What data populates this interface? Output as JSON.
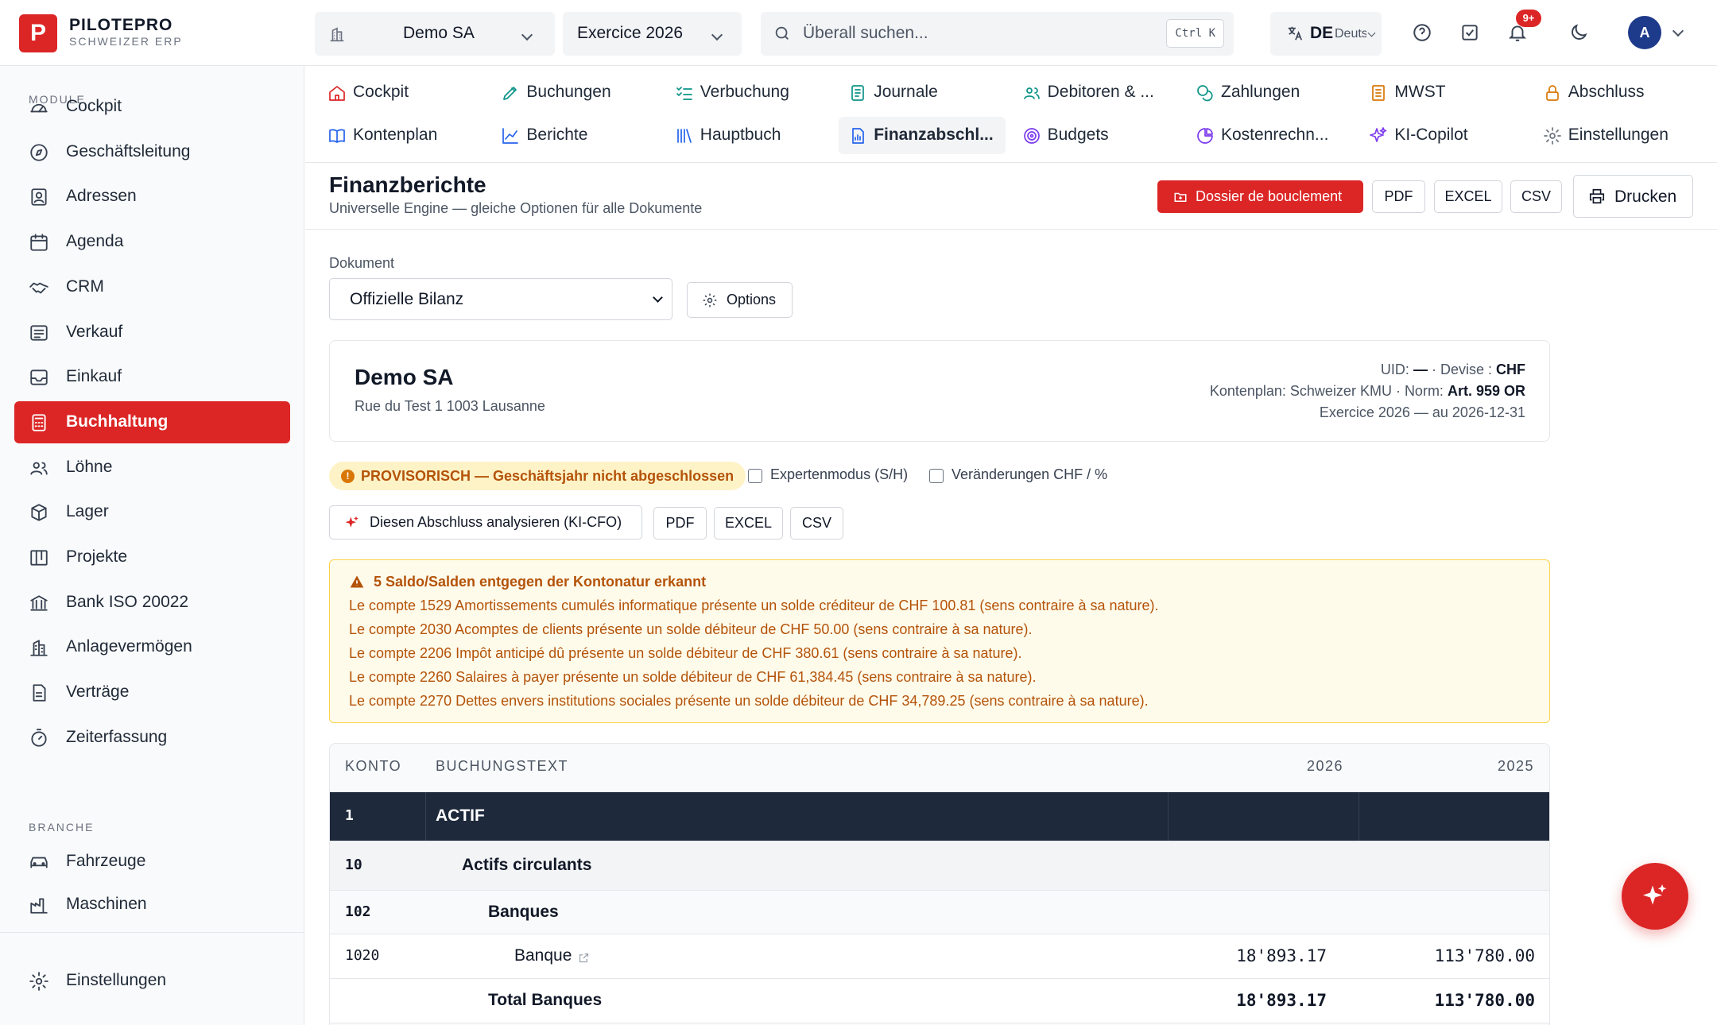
{
  "brand": {
    "logo_letter": "P",
    "name": "PILOTEPRO",
    "subtitle": "SCHWEIZER ERP"
  },
  "topbar": {
    "company": "Demo SA",
    "fiscal_year": "Exercice 2026",
    "search_placeholder": "Überall suchen...",
    "search_shortcut": "Ctrl K",
    "language_code": "DE",
    "language_name": "Deutsch",
    "notification_count": "9+",
    "avatar_initial": "A"
  },
  "sidebar": {
    "section_module": "MODULE",
    "items": [
      {
        "label": "Cockpit",
        "icon": "gauge-icon"
      },
      {
        "label": "Geschäftsleitung",
        "icon": "compass-icon"
      },
      {
        "label": "Adressen",
        "icon": "contact-card-icon"
      },
      {
        "label": "Agenda",
        "icon": "calendar-icon"
      },
      {
        "label": "CRM",
        "icon": "handshake-icon"
      },
      {
        "label": "Verkauf",
        "icon": "receipt-icon"
      },
      {
        "label": "Einkauf",
        "icon": "inbox-icon"
      },
      {
        "label": "Buchhaltung",
        "icon": "calculator-icon"
      },
      {
        "label": "Löhne",
        "icon": "users-icon"
      },
      {
        "label": "Lager",
        "icon": "box-icon"
      },
      {
        "label": "Projekte",
        "icon": "kanban-icon"
      },
      {
        "label": "Bank ISO 20022",
        "icon": "bank-icon"
      },
      {
        "label": "Anlagevermögen",
        "icon": "building-icon"
      },
      {
        "label": "Verträge",
        "icon": "document-icon"
      },
      {
        "label": "Zeiterfassung",
        "icon": "timer-icon"
      }
    ],
    "section_branche": "BRANCHE",
    "branche_items": [
      {
        "label": "Fahrzeuge",
        "icon": "car-icon"
      },
      {
        "label": "Maschinen",
        "icon": "factory-icon"
      }
    ],
    "settings_label": "Einstellungen",
    "active_item": "Buchhaltung"
  },
  "module_tabs": {
    "row1": [
      "Cockpit",
      "Buchungen",
      "Verbuchung",
      "Journale",
      "Debitoren & ...",
      "Zahlungen",
      "MWST",
      "Abschluss"
    ],
    "row2": [
      "Kontenplan",
      "Berichte",
      "Hauptbuch",
      "Finanzabschl...",
      "Budgets",
      "Kostenrechn...",
      "KI-Copilot",
      "Einstellungen"
    ],
    "active_tab": "Finanzabschl..."
  },
  "page": {
    "title": "Finanzberichte",
    "subtitle": "Universelle Engine — gleiche Optionen für alle Dokumente",
    "dossier_button": "Dossier de bouclement",
    "pdf": "PDF",
    "excel": "EXCEL",
    "csv": "CSV",
    "print": "Drucken"
  },
  "document_selector": {
    "label": "Dokument",
    "selected": "Offizielle Bilanz",
    "options_button": "Options"
  },
  "company_card": {
    "name": "Demo SA",
    "address": "Rue du Test 1 1003 Lausanne",
    "uid_label": "UID:",
    "uid_value": "—",
    "currency_label": "· Devise :",
    "currency_value": "CHF",
    "chart_label": "Kontenplan: Schweizer KMU · Norm:",
    "norm_value": "Art. 959 OR",
    "period": "Exercice 2026 — au 2026-12-31"
  },
  "options_bar": {
    "provisional_badge": "PROVISORISCH — Geschäftsjahr nicht abgeschlossen",
    "expert_mode": "Expertenmodus (S/H)",
    "changes": "Veränderungen CHF / %",
    "analyze_button": "Diesen Abschluss analysieren (KI-CFO)",
    "pdf": "PDF",
    "excel": "EXCEL",
    "csv": "CSV"
  },
  "warning": {
    "title": "5 Saldo/Salden entgegen der Kontonatur erkannt",
    "lines": [
      "Le compte 1529 Amortissements cumulés informatique présente un solde créditeur de CHF 100.81 (sens contraire à sa nature).",
      "Le compte 2030 Acomptes de clients présente un solde débiteur de CHF 50.00 (sens contraire à sa nature).",
      "Le compte 2206 Impôt anticipé dû présente un solde débiteur de CHF 380.61 (sens contraire à sa nature).",
      "Le compte 2260 Salaires à payer présente un solde débiteur de CHF 61,384.45 (sens contraire à sa nature).",
      "Le compte 2270 Dettes envers institutions sociales présente un solde débiteur de CHF 34,789.25 (sens contraire à sa nature)."
    ]
  },
  "table": {
    "headers": {
      "account": "KONTO",
      "text": "BUCHUNGSTEXT",
      "year1": "2026",
      "year2": "2025"
    },
    "rows": [
      {
        "account": "1",
        "text": "ACTIF",
        "v1": "",
        "v2": ""
      },
      {
        "account": "10",
        "text": "Actifs circulants",
        "v1": "",
        "v2": ""
      },
      {
        "account": "102",
        "text": "Banques",
        "v1": "",
        "v2": ""
      },
      {
        "account": "1020",
        "text": "Banque",
        "v1": "18'893.17",
        "v2": "113'780.00"
      },
      {
        "account": "",
        "text": "Total Banques",
        "v1": "18'893.17",
        "v2": "113'780.00"
      }
    ]
  },
  "colors": {
    "accent": "#dc2626",
    "navy": "#1e293b",
    "warning_bg": "#fffbeb",
    "warning_border": "#fcd34d",
    "warning_text": "#b45309"
  }
}
